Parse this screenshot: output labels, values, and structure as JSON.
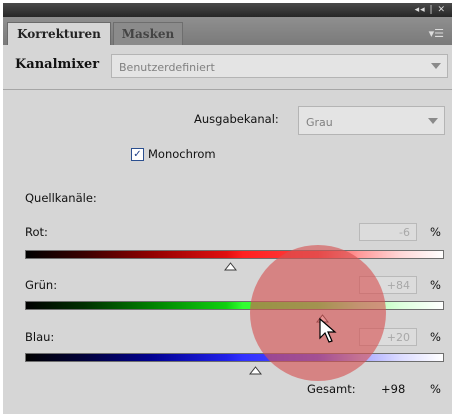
{
  "window": {
    "controls": "◂◂ | ✕",
    "menu_icon": "menu-icon"
  },
  "tabs": [
    {
      "label": "Korrekturen",
      "active": true
    },
    {
      "label": "Masken",
      "active": false
    }
  ],
  "header": {
    "title": "Kanalmixer",
    "preset": "Benutzerdefiniert"
  },
  "output": {
    "label": "Ausgabekanal:",
    "value": "Grau"
  },
  "monochrome": {
    "label": "Monochrom",
    "checked": true,
    "check_glyph": "✓"
  },
  "source_label": "Quellkanäle:",
  "channels": [
    {
      "name": "Rot:",
      "value": "-6",
      "unit": "%",
      "level_fraction": 0.49
    },
    {
      "name": "Grün:",
      "value": "+84",
      "unit": "%",
      "level_fraction": 0.71
    },
    {
      "name": "Blau:",
      "value": "+20",
      "unit": "%",
      "level_fraction": 0.55
    }
  ],
  "total": {
    "label": "Gesamt:",
    "value": "+98",
    "unit": "%"
  },
  "colors": {
    "red": "#e81010",
    "green": "#10d010",
    "blue": "#2020e8",
    "highlight": "#d65050"
  }
}
